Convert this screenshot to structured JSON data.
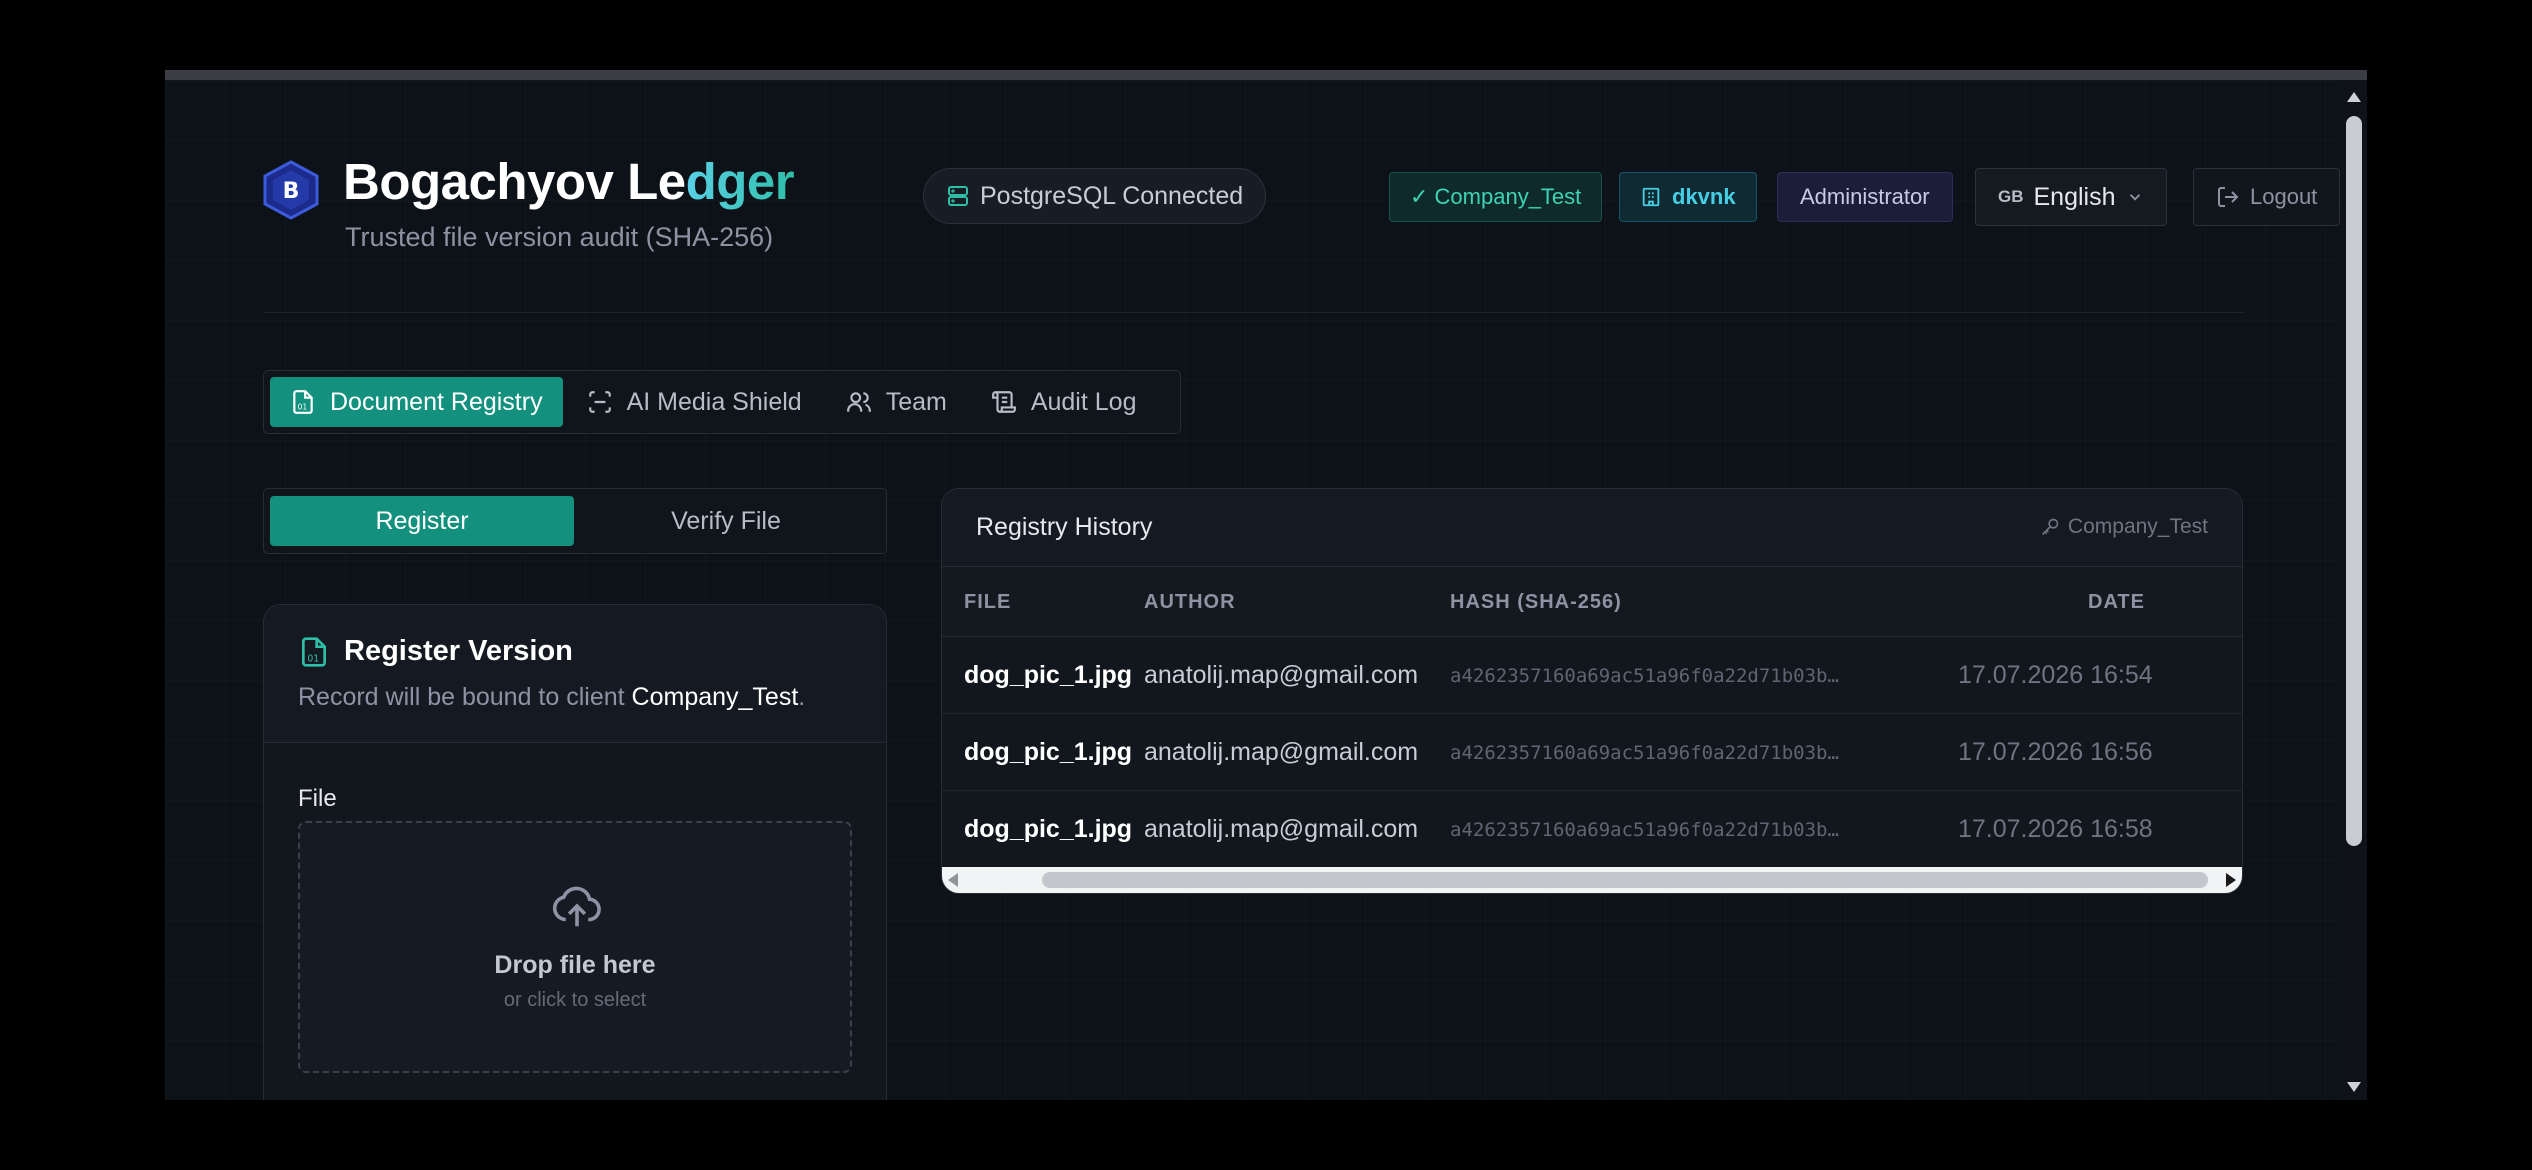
{
  "brand": {
    "title_part1": "Bogachyov Le",
    "title_part2": "dger",
    "subtitle": "Trusted file version audit (SHA-256)"
  },
  "status": {
    "db": "PostgreSQL Connected",
    "company": "✓ Company_Test",
    "user": "dkvnk",
    "role": "Administrator",
    "lang_flag": "GB",
    "lang": "English",
    "logout": "Logout"
  },
  "nav": {
    "tabs": [
      {
        "label": "Document Registry",
        "icon": "file-binary-icon",
        "active": true
      },
      {
        "label": "AI Media Shield",
        "icon": "scan-icon",
        "active": false
      },
      {
        "label": "Team",
        "icon": "users-icon",
        "active": false
      },
      {
        "label": "Audit Log",
        "icon": "scroll-icon",
        "active": false
      }
    ]
  },
  "subtabs": [
    {
      "label": "Register",
      "active": true
    },
    {
      "label": "Verify File",
      "active": false
    }
  ],
  "register": {
    "title": "Register Version",
    "desc_prefix": "Record will be bound to client ",
    "desc_client": "Company_Test",
    "desc_suffix": ".",
    "file_label": "File",
    "drop_title": "Drop file here",
    "drop_sub": "or click to select"
  },
  "history": {
    "title": "Registry History",
    "client": "Company_Test",
    "columns": [
      "FILE",
      "AUTHOR",
      "HASH (SHA-256)",
      "DATE"
    ],
    "rows": [
      {
        "file": "dog_pic_1.jpg",
        "author": "anatolij.map@gmail.com",
        "hash": "a4262357160a69ac51a96f0a22d71b03b…",
        "date": "17.07.2026 16:54"
      },
      {
        "file": "dog_pic_1.jpg",
        "author": "anatolij.map@gmail.com",
        "hash": "a4262357160a69ac51a96f0a22d71b03b…",
        "date": "17.07.2026 16:56"
      },
      {
        "file": "dog_pic_1.jpg",
        "author": "anatolij.map@gmail.com",
        "hash": "a4262357160a69ac51a96f0a22d71b03b…",
        "date": "17.07.2026 16:58"
      }
    ]
  },
  "colors": {
    "accent": "#14907e",
    "background": "#0d1118",
    "panel": "#12161d"
  }
}
